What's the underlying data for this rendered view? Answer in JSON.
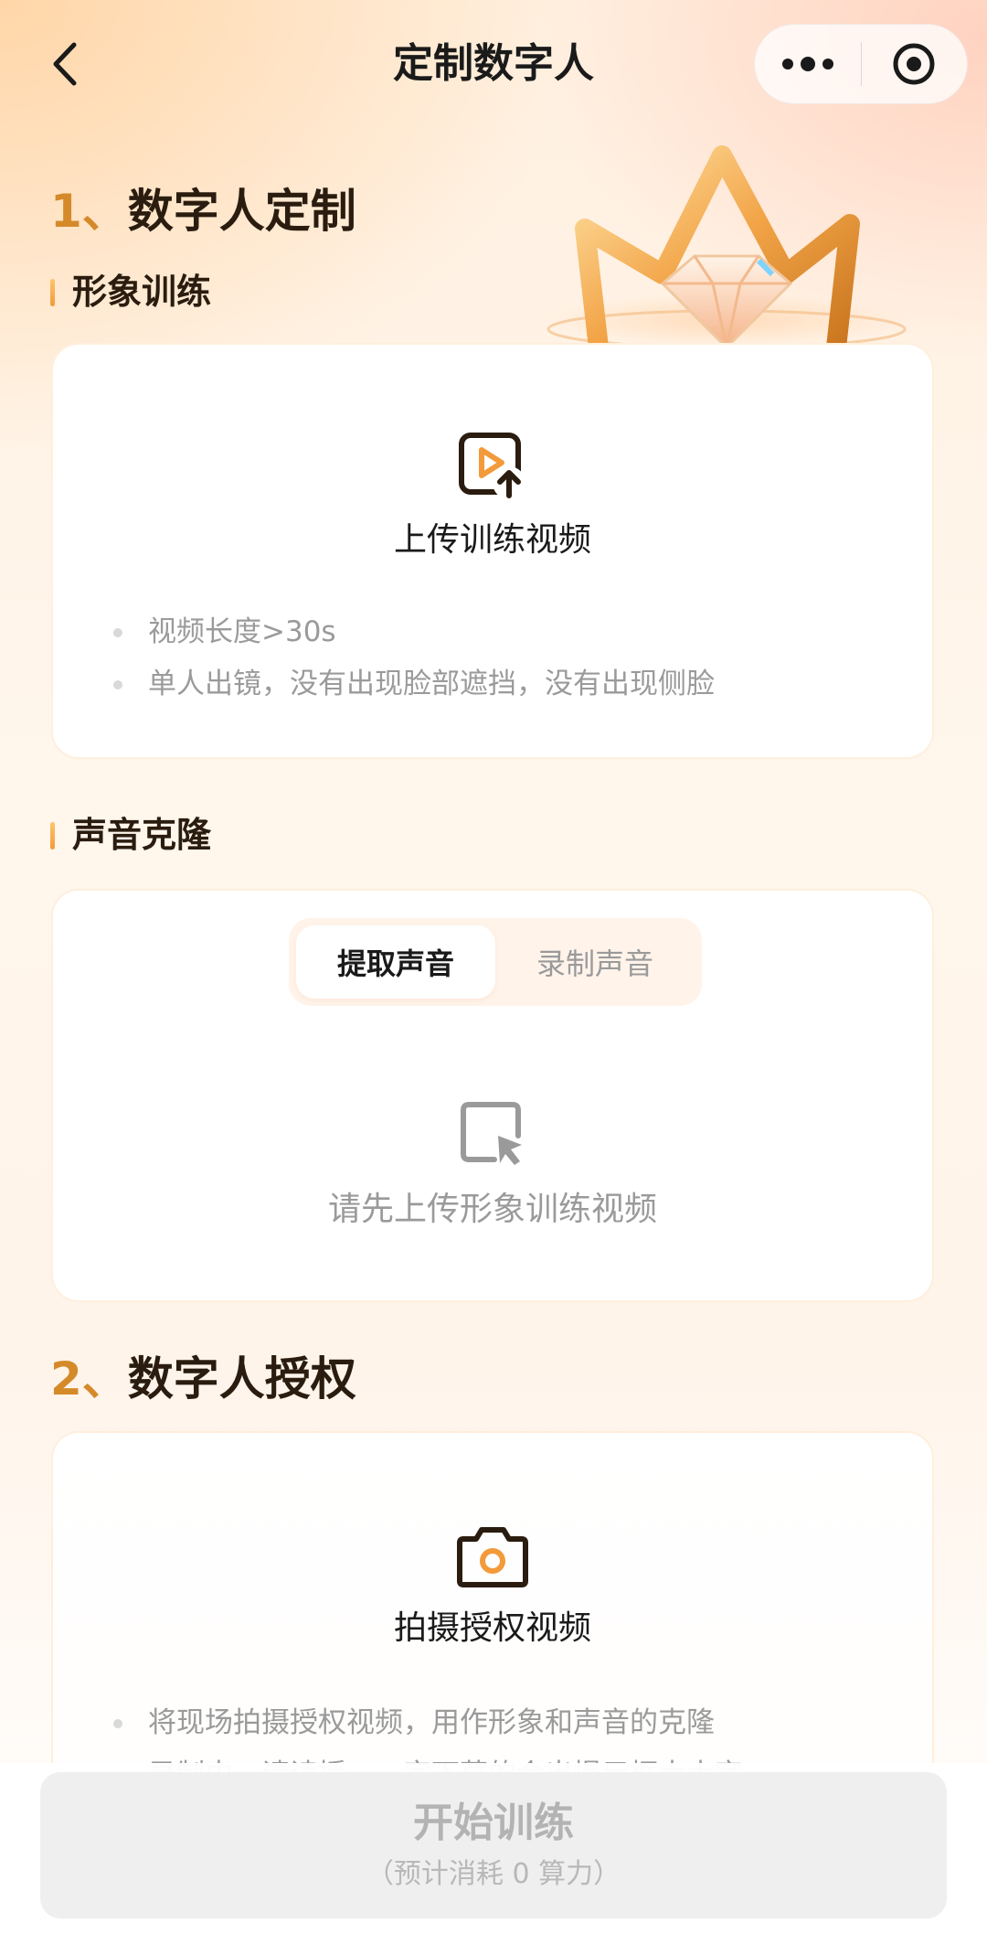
{
  "nav": {
    "title": "定制数字人",
    "back_icon": "chevron-left-icon",
    "more_icon": "more-dots-icon",
    "close_icon": "target-circle-icon"
  },
  "section1": {
    "num": "1、",
    "title": "数字人定制",
    "image_training": {
      "subtitle": "形象训练",
      "upload_label": "上传训练视频",
      "upload_icon": "video-upload-icon",
      "bullets": [
        "视频长度>30s",
        "单人出镜，没有出现脸部遮挡，没有出现侧脸"
      ]
    },
    "voice_clone": {
      "subtitle": "声音克隆",
      "tabs": [
        {
          "label": "提取声音",
          "active": true
        },
        {
          "label": "录制声音",
          "active": false
        }
      ],
      "hint_icon": "select-cursor-icon",
      "hint": "请先上传形象训练视频"
    }
  },
  "section2": {
    "num": "2、",
    "title": "数字人授权",
    "camera_icon": "camera-icon",
    "label": "拍摄授权视频",
    "bullets": [
      "将现场拍摄授权视频，用作形象和声音的克隆",
      "录制中，请读授……字下草的会出提示框大大字"
    ]
  },
  "footer": {
    "start_label": "开始训练",
    "cost_label": "（预计消耗 0 算力）"
  },
  "colors": {
    "accent": "#f39a3a",
    "heading": "#2a1c0f",
    "muted": "#9a9a9a"
  }
}
